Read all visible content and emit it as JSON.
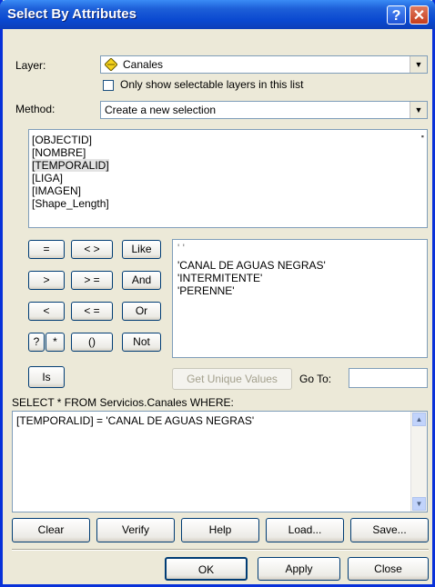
{
  "window": {
    "title": "Select By Attributes"
  },
  "layer": {
    "label": "Layer:",
    "value": "Canales",
    "checkbox_label": "Only show selectable layers in this list"
  },
  "method": {
    "label": "Method:",
    "value": "Create a new selection"
  },
  "fields": [
    "[OBJECTID]",
    "[NOMBRE]",
    "[TEMPORALID]",
    "[LIGA]",
    "[IMAGEN]",
    "[Shape_Length]"
  ],
  "operators": {
    "eq": "=",
    "ne": "< >",
    "like": "Like",
    "gt": ">",
    "ge": "> =",
    "and": "And",
    "lt": "<",
    "le": "< =",
    "or": "Or",
    "q": "?",
    "star": "*",
    "paren": "()",
    "not": "Not",
    "is": "Is"
  },
  "values": [
    "' '",
    "'CANAL DE AGUAS NEGRAS'",
    "'INTERMITENTE'",
    "'PERENNE'"
  ],
  "unique": {
    "button": "Get Unique Values",
    "goto_label": "Go To:",
    "goto_value": ""
  },
  "sql": {
    "label": "SELECT * FROM Servicios.Canales WHERE:",
    "expression": "[TEMPORALID] = 'CANAL DE AGUAS NEGRAS'"
  },
  "bottom_buttons": {
    "clear": "Clear",
    "verify": "Verify",
    "help": "Help",
    "load": "Load...",
    "save": "Save..."
  },
  "dialog_buttons": {
    "ok": "OK",
    "apply": "Apply",
    "close": "Close"
  },
  "colors": {
    "titlebar": "#0a48d0",
    "face": "#ece9d8",
    "border": "#7f9db9"
  }
}
